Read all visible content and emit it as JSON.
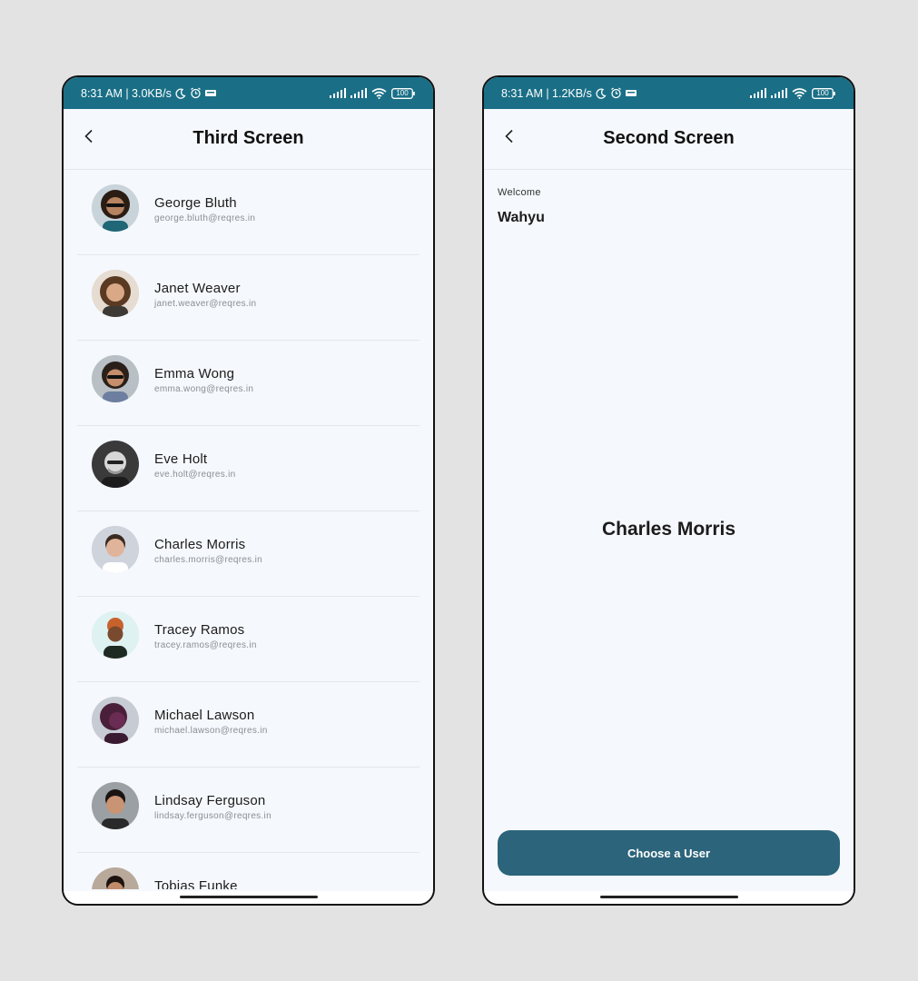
{
  "left_screen": {
    "status": {
      "time_speed": "8:31 AM | 3.0KB/s",
      "battery": "100",
      "icons": [
        "moon-icon",
        "alarm-icon",
        "cnn-icon",
        "signal-icon",
        "signal-icon",
        "wifi-icon",
        "battery-icon"
      ]
    },
    "title": "Third Screen",
    "back_icon": "chevron-left-icon",
    "users": [
      {
        "name": "George Bluth",
        "email": "george.bluth@reqres.in"
      },
      {
        "name": "Janet Weaver",
        "email": "janet.weaver@reqres.in"
      },
      {
        "name": "Emma Wong",
        "email": "emma.wong@reqres.in"
      },
      {
        "name": "Eve Holt",
        "email": "eve.holt@reqres.in"
      },
      {
        "name": "Charles Morris",
        "email": "charles.morris@reqres.in"
      },
      {
        "name": "Tracey Ramos",
        "email": "tracey.ramos@reqres.in"
      },
      {
        "name": "Michael Lawson",
        "email": "michael.lawson@reqres.in"
      },
      {
        "name": "Lindsay Ferguson",
        "email": "lindsay.ferguson@reqres.in"
      },
      {
        "name": "Tobias Funke",
        "email": ""
      }
    ]
  },
  "right_screen": {
    "status": {
      "time_speed": "8:31 AM | 1.2KB/s",
      "battery": "100"
    },
    "title": "Second Screen",
    "back_icon": "chevron-left-icon",
    "welcome_label": "Welcome",
    "welcome_name": "Wahyu",
    "selected_user": "Charles Morris",
    "choose_button_label": "Choose a User"
  },
  "colors": {
    "status_bar": "#1a6f86",
    "button": "#2b647b",
    "screen_background": "#f5f8fc",
    "page_background": "#e3e3e3"
  }
}
